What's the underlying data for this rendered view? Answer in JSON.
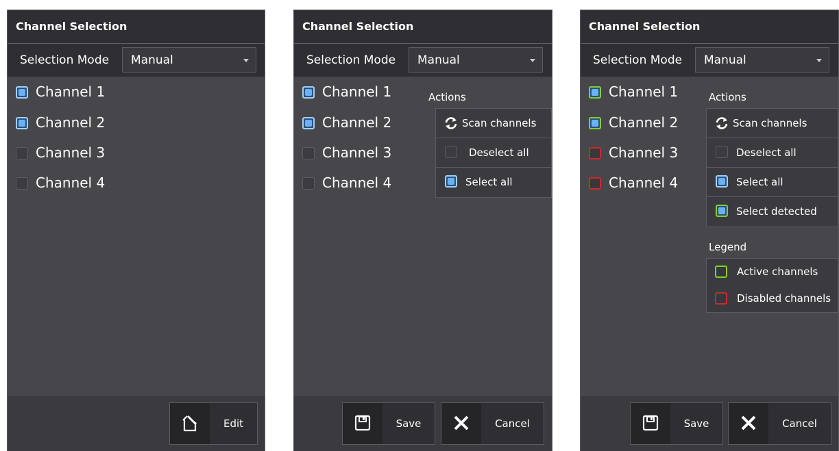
{
  "panels": [
    {
      "title": "Channel Selection",
      "mode_label": "Selection Mode",
      "mode_value": "Manual",
      "channels": [
        {
          "label": "Channel 1",
          "checked": true,
          "status": ""
        },
        {
          "label": "Channel 2",
          "checked": true,
          "status": ""
        },
        {
          "label": "Channel 3",
          "checked": false,
          "status": ""
        },
        {
          "label": "Channel 4",
          "checked": false,
          "status": ""
        }
      ],
      "footer": {
        "edit_label": "Edit"
      }
    },
    {
      "title": "Channel Selection",
      "mode_label": "Selection Mode",
      "mode_value": "Manual",
      "channels": [
        {
          "label": "Channel 1",
          "checked": true,
          "status": ""
        },
        {
          "label": "Channel 2",
          "checked": true,
          "status": ""
        },
        {
          "label": "Channel 3",
          "checked": false,
          "status": ""
        },
        {
          "label": "Channel 4",
          "checked": false,
          "status": ""
        }
      ],
      "actions_heading": "Actions",
      "actions": {
        "scan": "Scan channels",
        "deselect": "Deselect all",
        "select": "Select all"
      },
      "footer": {
        "save_label": "Save",
        "cancel_label": "Cancel"
      }
    },
    {
      "title": "Channel Selection",
      "mode_label": "Selection Mode",
      "mode_value": "Manual",
      "channels": [
        {
          "label": "Channel 1",
          "checked": true,
          "status": "active"
        },
        {
          "label": "Channel 2",
          "checked": true,
          "status": "active"
        },
        {
          "label": "Channel 3",
          "checked": false,
          "status": "disabled"
        },
        {
          "label": "Channel 4",
          "checked": false,
          "status": "disabled"
        }
      ],
      "actions_heading": "Actions",
      "actions": {
        "scan": "Scan channels",
        "deselect": "Deselect all",
        "select": "Select all",
        "select_detected": "Select detected"
      },
      "legend_heading": "Legend",
      "legend": {
        "active": "Active channels",
        "disabled": "Disabled channels"
      },
      "footer": {
        "save_label": "Save",
        "cancel_label": "Cancel"
      }
    }
  ],
  "colors": {
    "panel_bg": "#47474b",
    "header_bg": "#2f2f33",
    "checked_fill": "#6ab1f5",
    "active_border": "#7dd037",
    "disabled_border": "#ce2929"
  },
  "icons": [
    "edit-icon",
    "save-icon",
    "close-icon",
    "refresh-icon",
    "dropdown-caret-icon"
  ]
}
